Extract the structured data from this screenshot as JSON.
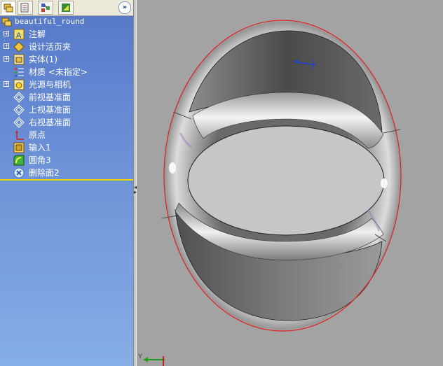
{
  "panel": {
    "tabs": [
      {
        "name": "featuremanager-tab",
        "active": true
      },
      {
        "name": "propertymanager-tab",
        "active": false
      },
      {
        "name": "configurationmanager-tab",
        "active": false
      },
      {
        "name": "dimxpert-tab",
        "active": false
      }
    ],
    "collapse_label": "»"
  },
  "tree": {
    "root": "beautiful_round",
    "items": [
      {
        "label": "注解",
        "icon": "annotations-icon",
        "expandable": true
      },
      {
        "label": "设计活页夹",
        "icon": "design-binder-icon",
        "expandable": true
      },
      {
        "label": "实体(1)",
        "icon": "solid-bodies-icon",
        "expandable": true
      },
      {
        "label": "材质 <未指定>",
        "icon": "material-icon",
        "expandable": false
      },
      {
        "label": "光源与相机",
        "icon": "lights-cameras-icon",
        "expandable": true
      },
      {
        "label": "前视基准面",
        "icon": "plane-icon",
        "expandable": false
      },
      {
        "label": "上视基准面",
        "icon": "plane-icon",
        "expandable": false
      },
      {
        "label": "右视基准面",
        "icon": "plane-icon",
        "expandable": false
      },
      {
        "label": "原点",
        "icon": "origin-icon",
        "expandable": false
      },
      {
        "label": "输入1",
        "icon": "imported-feature-icon",
        "expandable": false
      },
      {
        "label": "圆角3",
        "icon": "fillet-icon",
        "expandable": false
      },
      {
        "label": "删除面2",
        "icon": "delete-face-icon",
        "expandable": false,
        "selected": true
      }
    ]
  },
  "viewport": {
    "triad_label": "Y",
    "colors": {
      "background": "#a3a3a3",
      "highlight_edge": "#e02020",
      "model": "#c8c8c8"
    }
  }
}
